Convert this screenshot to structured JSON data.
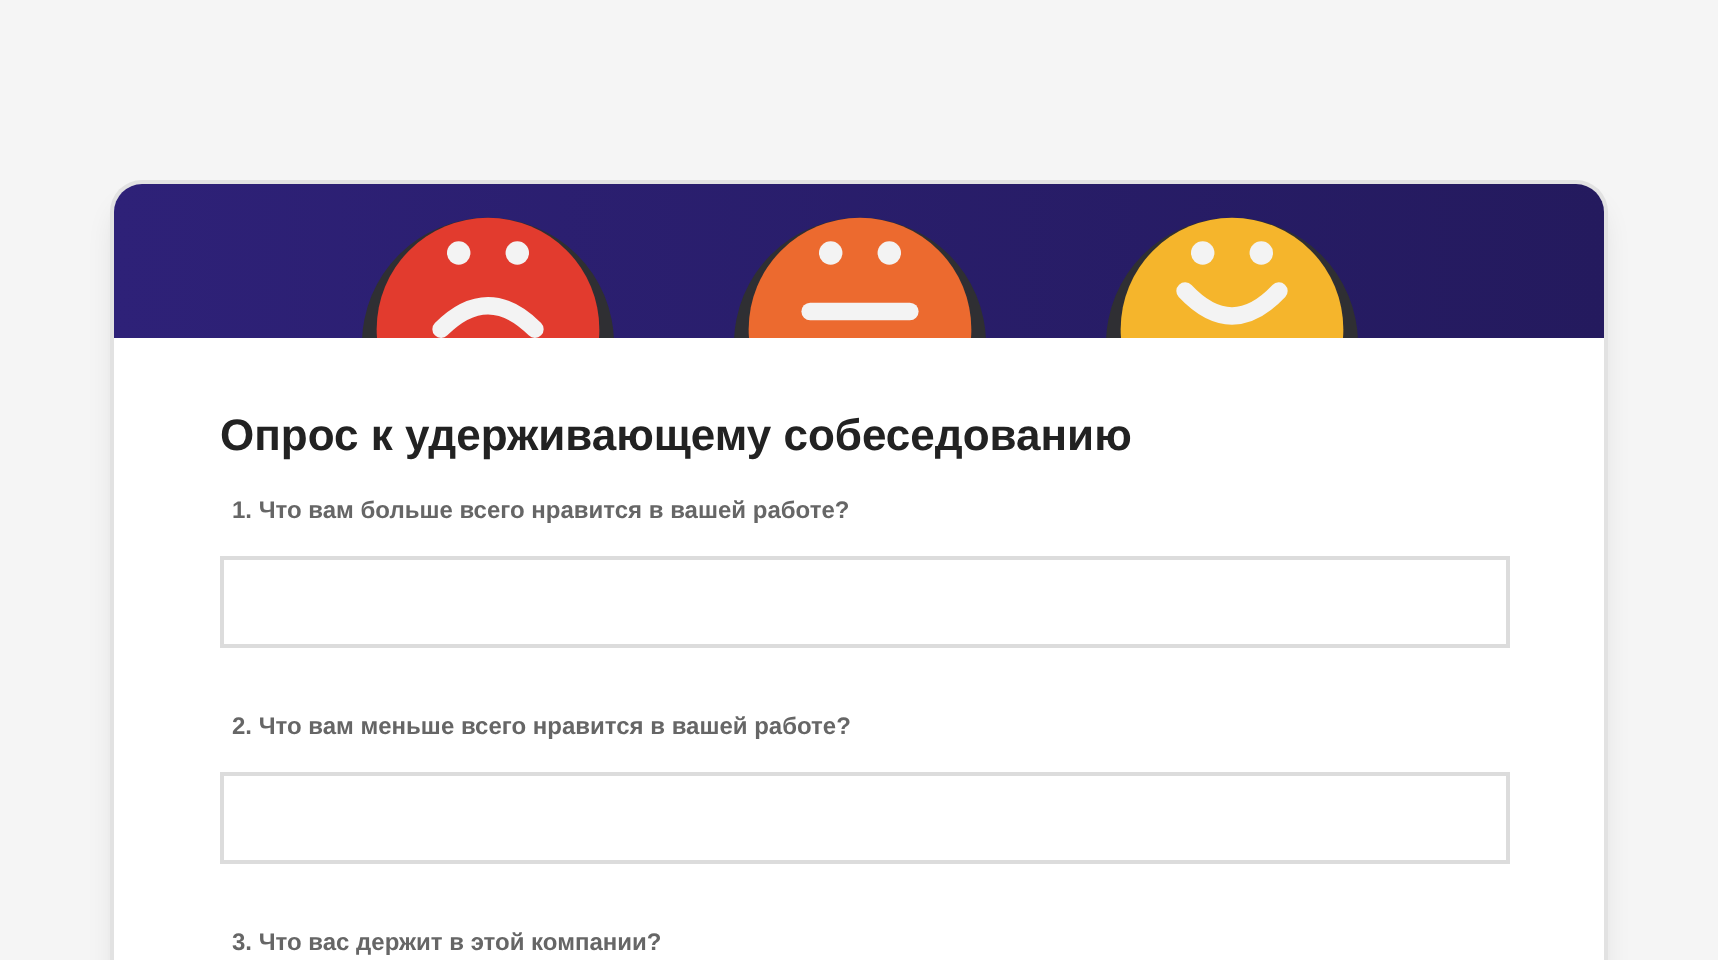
{
  "title": "Опрос к удерживающему собеседованию",
  "questions": [
    {
      "label": "1. Что вам больше всего нравится в вашей работе?"
    },
    {
      "label": "2. Что вам меньше всего нравится в вашей работе?"
    },
    {
      "label": "3. Что вас держит в этой компании?"
    }
  ]
}
